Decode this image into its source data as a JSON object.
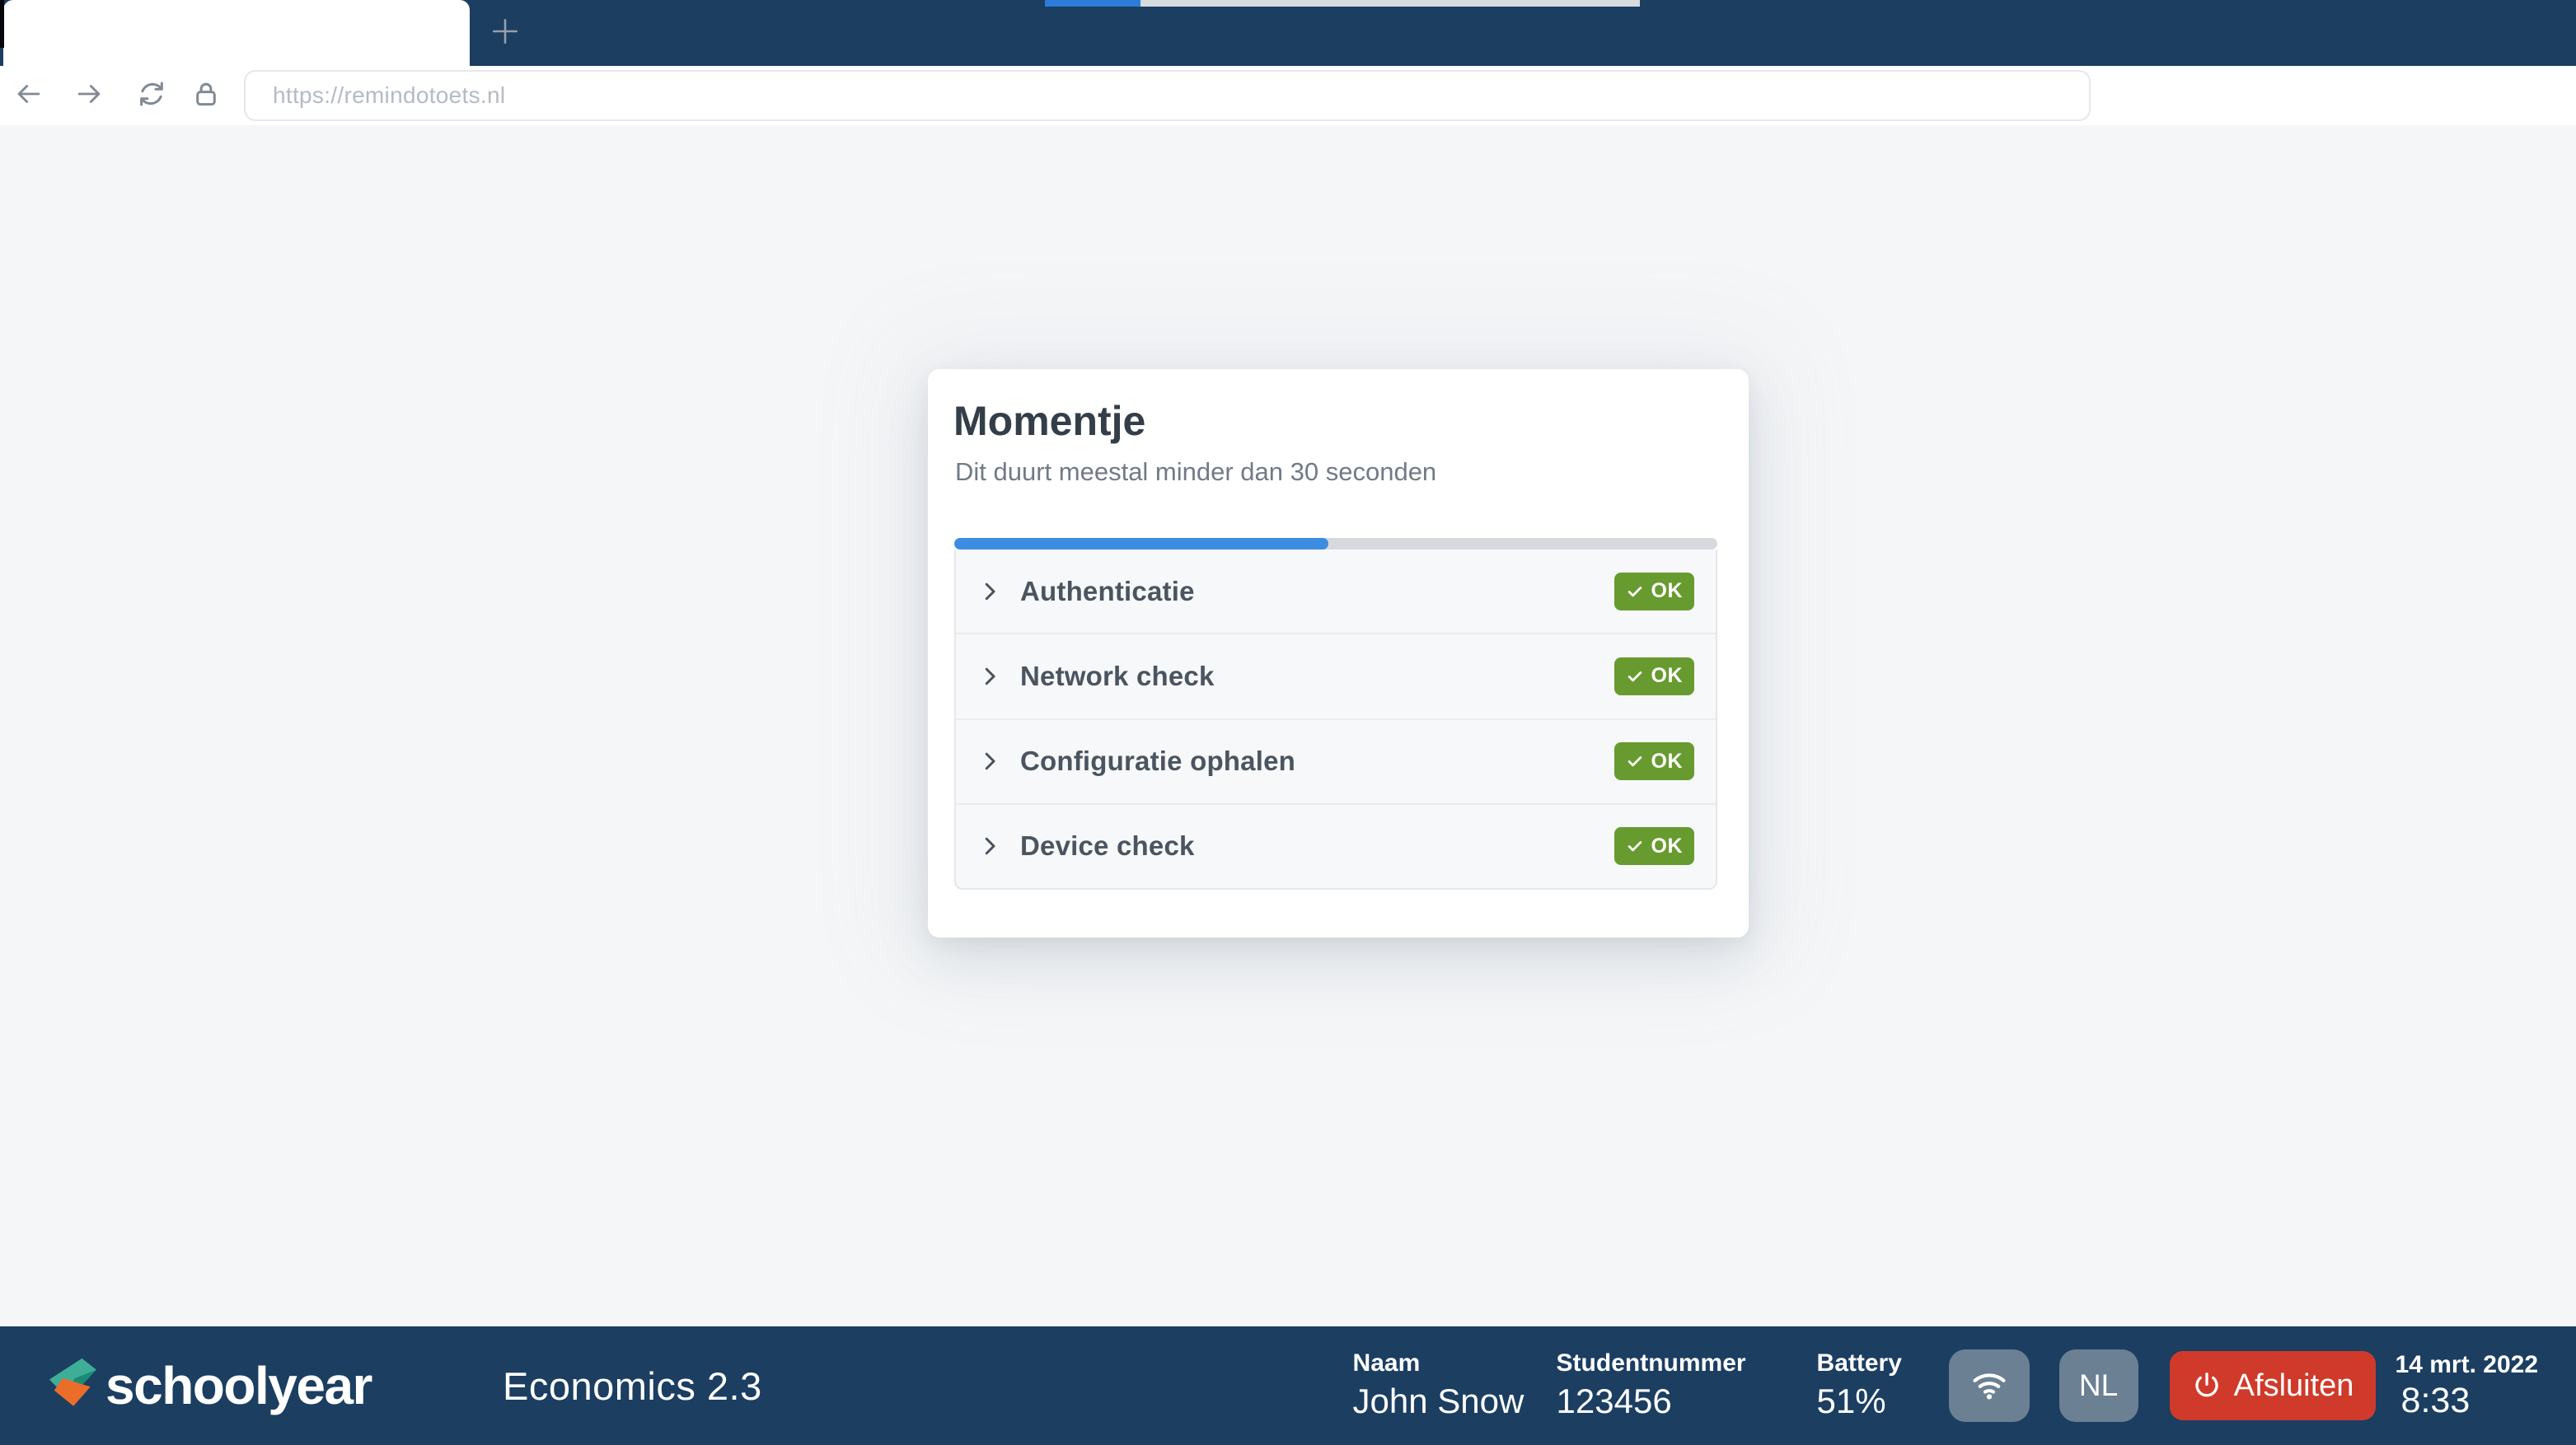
{
  "browser": {
    "url": "https://remindotoets.nl",
    "new_tab_icon": "plus",
    "nav_icons": [
      "arrow-left",
      "arrow-right",
      "reload-sync",
      "padlock"
    ],
    "top_loading_percent": 16
  },
  "card": {
    "title": "Momentje",
    "subtitle": "Dit duurt meestal minder dan 30 seconden",
    "progress_percent": 49,
    "checks": [
      {
        "label": "Authenticatie",
        "status": "OK"
      },
      {
        "label": "Network check",
        "status": "OK"
      },
      {
        "label": "Configuratie ophalen",
        "status": "OK"
      },
      {
        "label": "Device check",
        "status": "OK"
      }
    ]
  },
  "footer": {
    "brand": "schoolyear",
    "exam_title": "Economics 2.3",
    "fields": [
      {
        "label": "Naam",
        "value": "John Snow"
      },
      {
        "label": "Studentnummer",
        "value": "123456"
      },
      {
        "label": "Battery",
        "value": "51%"
      }
    ],
    "wifi_icon": "wifi",
    "language": "NL",
    "quit_icon": "power",
    "quit_label": "Afsluiten",
    "date": "14 mrt. 2022",
    "time": "8:33"
  },
  "colors": {
    "navy": "#1b3e61",
    "accent_blue": "#3c8ce2",
    "top_loading_blue": "#2e7cd9",
    "success_green": "#689b2f",
    "danger_red": "#d03a2a",
    "pill_gray": "#6b8093",
    "logo_teal": "#3fae97",
    "logo_dark_teal": "#1a8a73",
    "logo_orange": "#ea6d2a"
  }
}
